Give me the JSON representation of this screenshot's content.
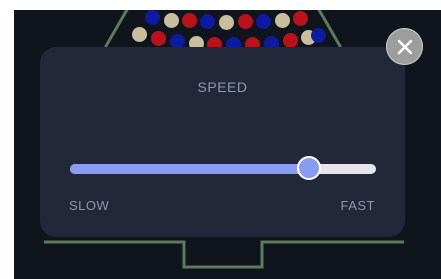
{
  "settings_modal": {
    "title": "SPEED",
    "speed_level": 0.78,
    "min_label": "SLOW",
    "max_label": "FAST",
    "close_icon": "close-icon"
  },
  "colors": {
    "board_background": "#10141c",
    "board_outline": "#5c7a5c",
    "panel_background": "#22283a",
    "accent": "#8a9bf4",
    "ball_red": "#b8121b",
    "ball_blue": "#0e1aa0",
    "ball_cream": "#c9bfa0"
  }
}
